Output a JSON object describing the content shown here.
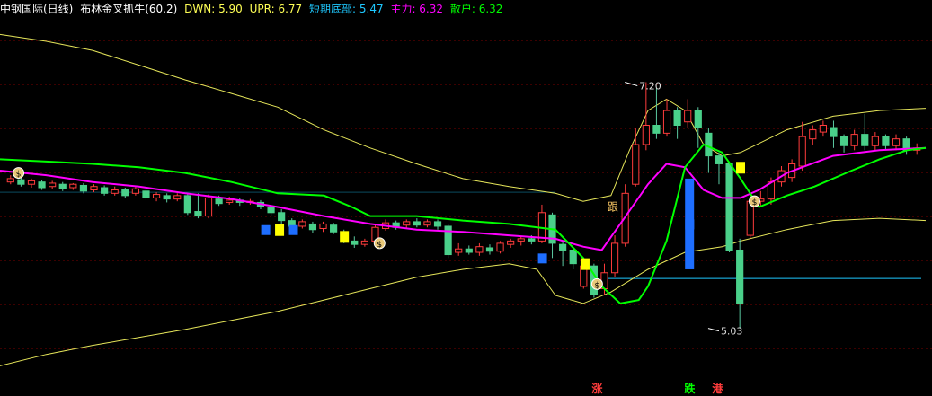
{
  "header": {
    "title": "中钢国际(日线)",
    "indicator": "布林金叉抓牛(60,2)",
    "dwn": "DWN: 5.90",
    "upr": "UPR: 6.77",
    "short_bottom": "短期底部: 5.47",
    "main_force": "主力: 6.32",
    "retail": "散户: 6.32"
  },
  "colors": {
    "up": "#ff3c3c",
    "down": "#00d0d0",
    "boll": "#e6e65a",
    "retail": "#00ff00",
    "main": "#ff00ff",
    "level": "#1ec8ff",
    "grid": "#7a0000",
    "text": "#c0c0c0"
  },
  "chart_data": {
    "type": "candlestick",
    "ylim": [
      4.6,
      7.75
    ],
    "annotations": {
      "high_label": "7.20",
      "low_label": "5.03",
      "marker_follow": "跟",
      "marker_up": "涨",
      "marker_down": "跌",
      "marker_harbor": "港"
    },
    "level_line": 5.47,
    "candles": [
      [
        6.32,
        6.35,
        6.38,
        6.3
      ],
      [
        6.34,
        6.3,
        6.36,
        6.28
      ],
      [
        6.3,
        6.33,
        6.35,
        6.27
      ],
      [
        6.32,
        6.27,
        6.34,
        6.25
      ],
      [
        6.28,
        6.31,
        6.33,
        6.26
      ],
      [
        6.3,
        6.26,
        6.32,
        6.24
      ],
      [
        6.27,
        6.3,
        6.31,
        6.25
      ],
      [
        6.29,
        6.24,
        6.31,
        6.22
      ],
      [
        6.25,
        6.28,
        6.3,
        6.23
      ],
      [
        6.27,
        6.22,
        6.29,
        6.2
      ],
      [
        6.22,
        6.25,
        6.28,
        6.2
      ],
      [
        6.25,
        6.2,
        6.27,
        6.18
      ],
      [
        6.22,
        6.26,
        6.28,
        6.2
      ],
      [
        6.24,
        6.18,
        6.26,
        6.16
      ],
      [
        6.18,
        6.21,
        6.23,
        6.15
      ],
      [
        6.2,
        6.17,
        6.22,
        6.14
      ],
      [
        6.17,
        6.2,
        6.22,
        6.15
      ],
      [
        6.2,
        6.05,
        6.22,
        6.03
      ],
      [
        6.06,
        6.02,
        6.22,
        6.0
      ],
      [
        6.02,
        6.18,
        6.21,
        6.0
      ],
      [
        6.17,
        6.13,
        6.2,
        6.11
      ],
      [
        6.14,
        6.16,
        6.19,
        6.12
      ],
      [
        6.16,
        6.14,
        6.18,
        6.11
      ],
      [
        6.14,
        6.15,
        6.17,
        6.12
      ],
      [
        6.14,
        6.1,
        6.16,
        6.08
      ],
      [
        6.1,
        6.05,
        6.12,
        6.02
      ],
      [
        6.05,
        5.98,
        6.08,
        5.95
      ],
      [
        5.98,
        5.93,
        6.0,
        5.9
      ],
      [
        5.93,
        5.97,
        5.99,
        5.91
      ],
      [
        5.95,
        5.9,
        5.97,
        5.87
      ],
      [
        5.91,
        5.95,
        5.97,
        5.88
      ],
      [
        5.94,
        5.88,
        5.96,
        5.86
      ],
      [
        5.88,
        5.8,
        5.9,
        5.78
      ],
      [
        5.8,
        5.77,
        5.84,
        5.74
      ],
      [
        5.77,
        5.8,
        5.82,
        5.75
      ],
      [
        5.8,
        5.92,
        5.94,
        5.78
      ],
      [
        5.91,
        5.96,
        5.99,
        5.89
      ],
      [
        5.96,
        5.92,
        5.98,
        5.9
      ],
      [
        5.94,
        5.97,
        5.99,
        5.91
      ],
      [
        5.97,
        5.94,
        6.0,
        5.92
      ],
      [
        5.94,
        5.97,
        5.99,
        5.92
      ],
      [
        5.97,
        5.93,
        5.99,
        5.9
      ],
      [
        5.93,
        5.68,
        5.95,
        5.65
      ],
      [
        5.7,
        5.73,
        5.78,
        5.67
      ],
      [
        5.73,
        5.7,
        5.76,
        5.68
      ],
      [
        5.7,
        5.75,
        5.78,
        5.67
      ],
      [
        5.74,
        5.71,
        5.77,
        5.68
      ],
      [
        5.71,
        5.78,
        5.8,
        5.69
      ],
      [
        5.77,
        5.8,
        5.82,
        5.74
      ],
      [
        5.8,
        5.82,
        5.84,
        5.76
      ],
      [
        5.82,
        5.8,
        5.85,
        5.77
      ],
      [
        5.8,
        6.05,
        6.12,
        5.78
      ],
      [
        6.03,
        5.78,
        6.05,
        5.65
      ],
      [
        5.77,
        5.72,
        5.8,
        5.58
      ],
      [
        5.72,
        5.6,
        5.74,
        5.55
      ],
      [
        5.4,
        5.58,
        5.6,
        5.38
      ],
      [
        5.58,
        5.33,
        5.6,
        5.3
      ],
      [
        5.38,
        5.52,
        5.6,
        5.32
      ],
      [
        5.52,
        5.78,
        5.85,
        5.48
      ],
      [
        5.78,
        6.22,
        6.3,
        5.75
      ],
      [
        6.3,
        6.65,
        6.8,
        6.28
      ],
      [
        6.65,
        6.82,
        7.2,
        6.6
      ],
      [
        6.82,
        6.75,
        7.15,
        6.7
      ],
      [
        6.75,
        6.95,
        7.05,
        6.72
      ],
      [
        6.95,
        6.82,
        6.98,
        6.7
      ],
      [
        6.85,
        6.95,
        7.05,
        6.8
      ],
      [
        6.95,
        6.8,
        6.98,
        6.62
      ],
      [
        6.75,
        6.55,
        6.8,
        6.4
      ],
      [
        6.55,
        6.48,
        6.58,
        6.3
      ],
      [
        6.48,
        5.72,
        6.5,
        5.7
      ],
      [
        5.72,
        5.25,
        5.82,
        5.03
      ],
      [
        5.85,
        6.15,
        6.22,
        5.82
      ],
      [
        6.15,
        6.17,
        6.24,
        6.1
      ],
      [
        6.17,
        6.32,
        6.36,
        6.12
      ],
      [
        6.32,
        6.42,
        6.46,
        6.28
      ],
      [
        6.36,
        6.48,
        6.52,
        6.32
      ],
      [
        6.46,
        6.72,
        6.85,
        6.42
      ],
      [
        6.7,
        6.78,
        6.82,
        6.65
      ],
      [
        6.76,
        6.82,
        6.86,
        6.72
      ],
      [
        6.8,
        6.72,
        6.86,
        6.62
      ],
      [
        6.72,
        6.64,
        6.74,
        6.58
      ],
      [
        6.64,
        6.74,
        6.78,
        6.6
      ],
      [
        6.74,
        6.64,
        6.92,
        6.6
      ],
      [
        6.64,
        6.72,
        6.76,
        6.6
      ],
      [
        6.72,
        6.64,
        6.74,
        6.6
      ],
      [
        6.64,
        6.7,
        6.74,
        6.6
      ],
      [
        6.7,
        6.6,
        6.72,
        6.56
      ],
      [
        6.6,
        6.62,
        6.66,
        6.56
      ]
    ],
    "boll_upper": [
      [
        0,
        7.62
      ],
      [
        0.05,
        7.56
      ],
      [
        0.1,
        7.48
      ],
      [
        0.15,
        7.35
      ],
      [
        0.2,
        7.22
      ],
      [
        0.25,
        7.1
      ],
      [
        0.3,
        6.98
      ],
      [
        0.35,
        6.78
      ],
      [
        0.4,
        6.62
      ],
      [
        0.45,
        6.48
      ],
      [
        0.5,
        6.35
      ],
      [
        0.55,
        6.28
      ],
      [
        0.6,
        6.22
      ],
      [
        0.63,
        6.15
      ],
      [
        0.66,
        6.2
      ],
      [
        0.68,
        6.6
      ],
      [
        0.7,
        6.95
      ],
      [
        0.72,
        7.05
      ],
      [
        0.74,
        6.95
      ],
      [
        0.76,
        6.65
      ],
      [
        0.78,
        6.55
      ],
      [
        0.8,
        6.58
      ],
      [
        0.85,
        6.78
      ],
      [
        0.9,
        6.9
      ],
      [
        0.95,
        6.95
      ],
      [
        1.0,
        6.97
      ]
    ],
    "boll_lower": [
      [
        0,
        4.7
      ],
      [
        0.05,
        4.8
      ],
      [
        0.1,
        4.88
      ],
      [
        0.15,
        4.95
      ],
      [
        0.2,
        5.02
      ],
      [
        0.25,
        5.1
      ],
      [
        0.3,
        5.18
      ],
      [
        0.35,
        5.28
      ],
      [
        0.4,
        5.38
      ],
      [
        0.45,
        5.48
      ],
      [
        0.5,
        5.55
      ],
      [
        0.55,
        5.6
      ],
      [
        0.58,
        5.55
      ],
      [
        0.6,
        5.32
      ],
      [
        0.63,
        5.25
      ],
      [
        0.66,
        5.35
      ],
      [
        0.7,
        5.55
      ],
      [
        0.74,
        5.7
      ],
      [
        0.78,
        5.75
      ],
      [
        0.8,
        5.8
      ],
      [
        0.85,
        5.9
      ],
      [
        0.9,
        5.98
      ],
      [
        0.95,
        6.0
      ],
      [
        1.0,
        5.98
      ]
    ],
    "main_force": [
      [
        0,
        6.42
      ],
      [
        0.05,
        6.38
      ],
      [
        0.1,
        6.32
      ],
      [
        0.15,
        6.28
      ],
      [
        0.2,
        6.22
      ],
      [
        0.25,
        6.17
      ],
      [
        0.3,
        6.1
      ],
      [
        0.35,
        6.02
      ],
      [
        0.4,
        5.95
      ],
      [
        0.45,
        5.9
      ],
      [
        0.5,
        5.88
      ],
      [
        0.55,
        5.85
      ],
      [
        0.6,
        5.82
      ],
      [
        0.63,
        5.75
      ],
      [
        0.65,
        5.72
      ],
      [
        0.67,
        5.95
      ],
      [
        0.7,
        6.3
      ],
      [
        0.72,
        6.48
      ],
      [
        0.74,
        6.45
      ],
      [
        0.76,
        6.25
      ],
      [
        0.78,
        6.18
      ],
      [
        0.8,
        6.18
      ],
      [
        0.82,
        6.25
      ],
      [
        0.85,
        6.4
      ],
      [
        0.9,
        6.55
      ],
      [
        0.95,
        6.6
      ],
      [
        1.0,
        6.62
      ]
    ],
    "retail_line": [
      [
        0,
        6.52
      ],
      [
        0.05,
        6.5
      ],
      [
        0.1,
        6.48
      ],
      [
        0.15,
        6.45
      ],
      [
        0.2,
        6.4
      ],
      [
        0.25,
        6.32
      ],
      [
        0.3,
        6.22
      ],
      [
        0.35,
        6.2
      ],
      [
        0.38,
        6.1
      ],
      [
        0.4,
        6.02
      ],
      [
        0.45,
        6.02
      ],
      [
        0.5,
        5.98
      ],
      [
        0.55,
        5.95
      ],
      [
        0.6,
        5.9
      ],
      [
        0.63,
        5.65
      ],
      [
        0.65,
        5.4
      ],
      [
        0.67,
        5.25
      ],
      [
        0.69,
        5.28
      ],
      [
        0.7,
        5.4
      ],
      [
        0.72,
        5.8
      ],
      [
        0.74,
        6.45
      ],
      [
        0.76,
        6.65
      ],
      [
        0.78,
        6.58
      ],
      [
        0.8,
        6.35
      ],
      [
        0.82,
        6.1
      ],
      [
        0.85,
        6.2
      ],
      [
        0.88,
        6.28
      ],
      [
        0.92,
        6.42
      ],
      [
        0.95,
        6.52
      ],
      [
        0.98,
        6.6
      ],
      [
        1.0,
        6.62
      ]
    ],
    "markers": [
      {
        "type": "bag",
        "x": 0.02,
        "y": 6.4
      },
      {
        "type": "bag",
        "x": 0.41,
        "y": 5.78
      },
      {
        "type": "bag",
        "x": 0.645,
        "y": 5.42
      },
      {
        "type": "bag",
        "x": 0.815,
        "y": 6.15
      },
      {
        "type": "follow",
        "x": 0.662,
        "y": 6.1
      },
      {
        "type": "yellow",
        "x": 0.372,
        "y": 5.84
      },
      {
        "type": "yellow",
        "x": 0.302,
        "y": 5.9
      },
      {
        "type": "yellow",
        "x": 0.632,
        "y": 5.6
      },
      {
        "type": "yellow",
        "x": 0.8,
        "y": 6.45
      },
      {
        "type": "blue",
        "x": 0.287,
        "y": 5.9
      },
      {
        "type": "blue",
        "x": 0.317,
        "y": 5.9
      },
      {
        "type": "blue",
        "x": 0.586,
        "y": 5.65
      },
      {
        "type": "blue",
        "x": 0.745,
        "y": 5.95
      }
    ]
  }
}
